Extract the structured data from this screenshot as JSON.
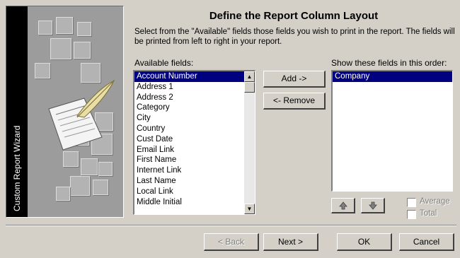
{
  "wizard": {
    "sidebar_title": "Custom Report Wizard",
    "page_title": "Define the Report Column Layout",
    "description": "Select from the \"Available\" fields those fields you wish to print in the report. The fields will be printed from left to right in your report."
  },
  "available": {
    "label": "Available fields:",
    "items": [
      "Account Number",
      "Address 1",
      "Address 2",
      "Category",
      "City",
      "Country",
      "Cust Date",
      "Email Link",
      "First Name",
      "Internet Link",
      "Last Name",
      "Local Link",
      "Middle Initial"
    ],
    "selected_index": 0
  },
  "selected": {
    "label": "Show these fields in this order:",
    "items": [
      "Company"
    ],
    "selected_index": 0
  },
  "actions": {
    "add": "Add ->",
    "remove": "<- Remove",
    "move_up_icon": "arrow-up-icon",
    "move_down_icon": "arrow-down-icon"
  },
  "options": {
    "average": "Average",
    "total": "Total",
    "average_checked": false,
    "total_checked": false
  },
  "footer": {
    "back": "< Back",
    "next": "Next >",
    "ok": "OK",
    "cancel": "Cancel"
  },
  "colors": {
    "dialog_bg": "#d4d0c8",
    "selection": "#000080"
  }
}
